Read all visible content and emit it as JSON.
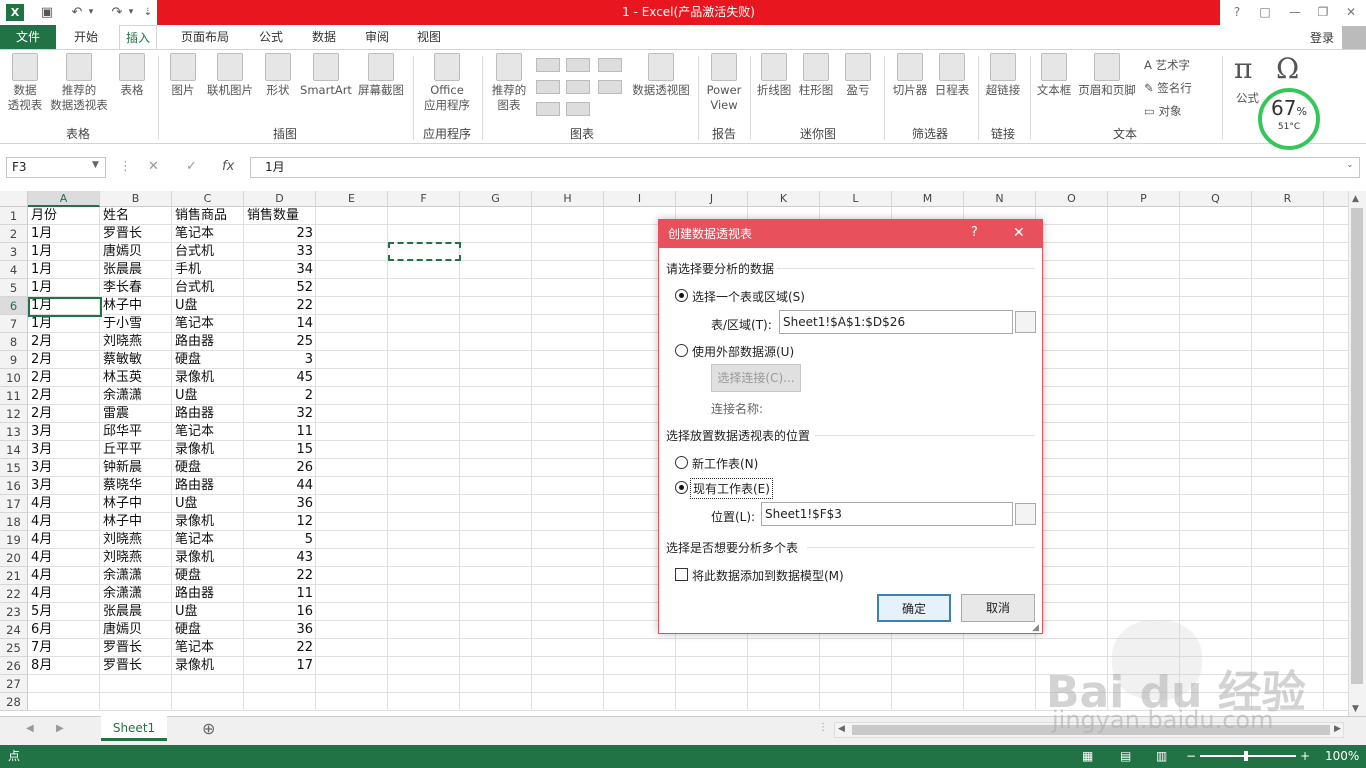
{
  "window": {
    "title": "1 -  Excel(产品激活失败)",
    "login": "登录",
    "help": "?",
    "ribbon_display": "□",
    "minimize": "—",
    "restore": "❐",
    "close": "✕"
  },
  "tabs": [
    "文件",
    "开始",
    "插入",
    "页面布局",
    "公式",
    "数据",
    "审阅",
    "视图"
  ],
  "active_tab": "插入",
  "ribbon": {
    "groups": [
      "表格",
      "插图",
      "应用程序",
      "图表",
      "报告",
      "迷你图",
      "筛选器",
      "链接",
      "文本"
    ],
    "buttons": {
      "pivot_table": [
        "数据",
        "透视表"
      ],
      "recommended_pivot": [
        "推荐的",
        "数据透视表"
      ],
      "table": "表格",
      "pictures": "图片",
      "online_pictures": "联机图片",
      "shapes": "形状",
      "smartart": "SmartArt",
      "screenshot": "屏幕截图",
      "office_apps": [
        "Office",
        "应用程序"
      ],
      "recommended_charts": [
        "推荐的",
        "图表"
      ],
      "pivot_chart": "数据透视图",
      "power_view": [
        "Power",
        "View"
      ],
      "line_spark": "折线图",
      "column_spark": "柱形图",
      "winloss": "盈亏",
      "slicer": "切片器",
      "timeline": "日程表",
      "hyperlink": "超链接",
      "textbox": "文本框",
      "header_footer": "页眉和页脚",
      "wordart": "艺术字",
      "signature": "签名行",
      "object": "对象",
      "equation": "公式"
    }
  },
  "widget": {
    "percent": "67",
    "percent_sign": "%",
    "temp": "51°C"
  },
  "formula_bar": {
    "name_box": "F3",
    "value": "1月",
    "fx": "fx"
  },
  "columns": [
    "A",
    "B",
    "C",
    "D",
    "E",
    "F",
    "G",
    "H",
    "I",
    "J",
    "K",
    "L",
    "M",
    "N",
    "O",
    "P",
    "Q",
    "R"
  ],
  "rows": [
    "1",
    "2",
    "3",
    "4",
    "5",
    "6",
    "7",
    "8",
    "9",
    "10",
    "11",
    "12",
    "13",
    "14",
    "15",
    "16",
    "17",
    "18",
    "19",
    "20",
    "21",
    "22",
    "23",
    "24",
    "25",
    "26",
    "27",
    "28"
  ],
  "table": [
    [
      "月份",
      "姓名",
      "销售商品",
      "销售数量"
    ],
    [
      "1月",
      "罗晋长",
      "笔记本",
      "23"
    ],
    [
      "1月",
      "唐嫣贝",
      "台式机",
      "33"
    ],
    [
      "1月",
      "张晨晨",
      "手机",
      "34"
    ],
    [
      "1月",
      "李长春",
      "台式机",
      "52"
    ],
    [
      "1月",
      "林子中",
      "U盘",
      "22"
    ],
    [
      "1月",
      "于小雪",
      "笔记本",
      "14"
    ],
    [
      "2月",
      "刘晓燕",
      "路由器",
      "25"
    ],
    [
      "2月",
      "蔡敏敏",
      "硬盘",
      "3"
    ],
    [
      "2月",
      "林玉英",
      "录像机",
      "45"
    ],
    [
      "2月",
      "余潇潇",
      "U盘",
      "2"
    ],
    [
      "2月",
      "雷震",
      "路由器",
      "32"
    ],
    [
      "3月",
      "邱华平",
      "笔记本",
      "11"
    ],
    [
      "3月",
      "丘平平",
      "录像机",
      "15"
    ],
    [
      "3月",
      "钟新晨",
      "硬盘",
      "26"
    ],
    [
      "3月",
      "蔡晓华",
      "路由器",
      "44"
    ],
    [
      "4月",
      "林子中",
      "U盘",
      "36"
    ],
    [
      "4月",
      "林子中",
      "录像机",
      "12"
    ],
    [
      "4月",
      "刘晓燕",
      "笔记本",
      "5"
    ],
    [
      "4月",
      "刘晓燕",
      "录像机",
      "43"
    ],
    [
      "4月",
      "余潇潇",
      "硬盘",
      "22"
    ],
    [
      "4月",
      "余潇潇",
      "路由器",
      "11"
    ],
    [
      "5月",
      "张晨晨",
      "U盘",
      "16"
    ],
    [
      "6月",
      "唐嫣贝",
      "硬盘",
      "36"
    ],
    [
      "7月",
      "罗晋长",
      "笔记本",
      "22"
    ],
    [
      "8月",
      "罗晋长",
      "录像机",
      "17"
    ]
  ],
  "dialog": {
    "title": "创建数据透视表",
    "help": "?",
    "close": "✕",
    "section1": "请选择要分析的数据",
    "opt_range": "选择一个表或区域(S)",
    "range_label": "表/区域(T):",
    "range_value": "Sheet1!$A$1:$D$26",
    "opt_external": "使用外部数据源(U)",
    "choose_conn": "选择连接(C)...",
    "conn_name": "连接名称:",
    "section2": "选择放置数据透视表的位置",
    "opt_new": "新工作表(N)",
    "opt_existing": "现有工作表(E)",
    "location_label": "位置(L):",
    "location_value": "Sheet1!$F$3",
    "section3": "选择是否想要分析多个表",
    "add_model": "将此数据添加到数据模型(M)",
    "ok": "确定",
    "cancel": "取消"
  },
  "sheet_tab": "Sheet1",
  "add_sheet": "⊕",
  "status": {
    "left": "点",
    "zoom": "100%"
  },
  "watermark": {
    "brand": "Bai du 经验",
    "url": "jingyan.baidu.com"
  }
}
